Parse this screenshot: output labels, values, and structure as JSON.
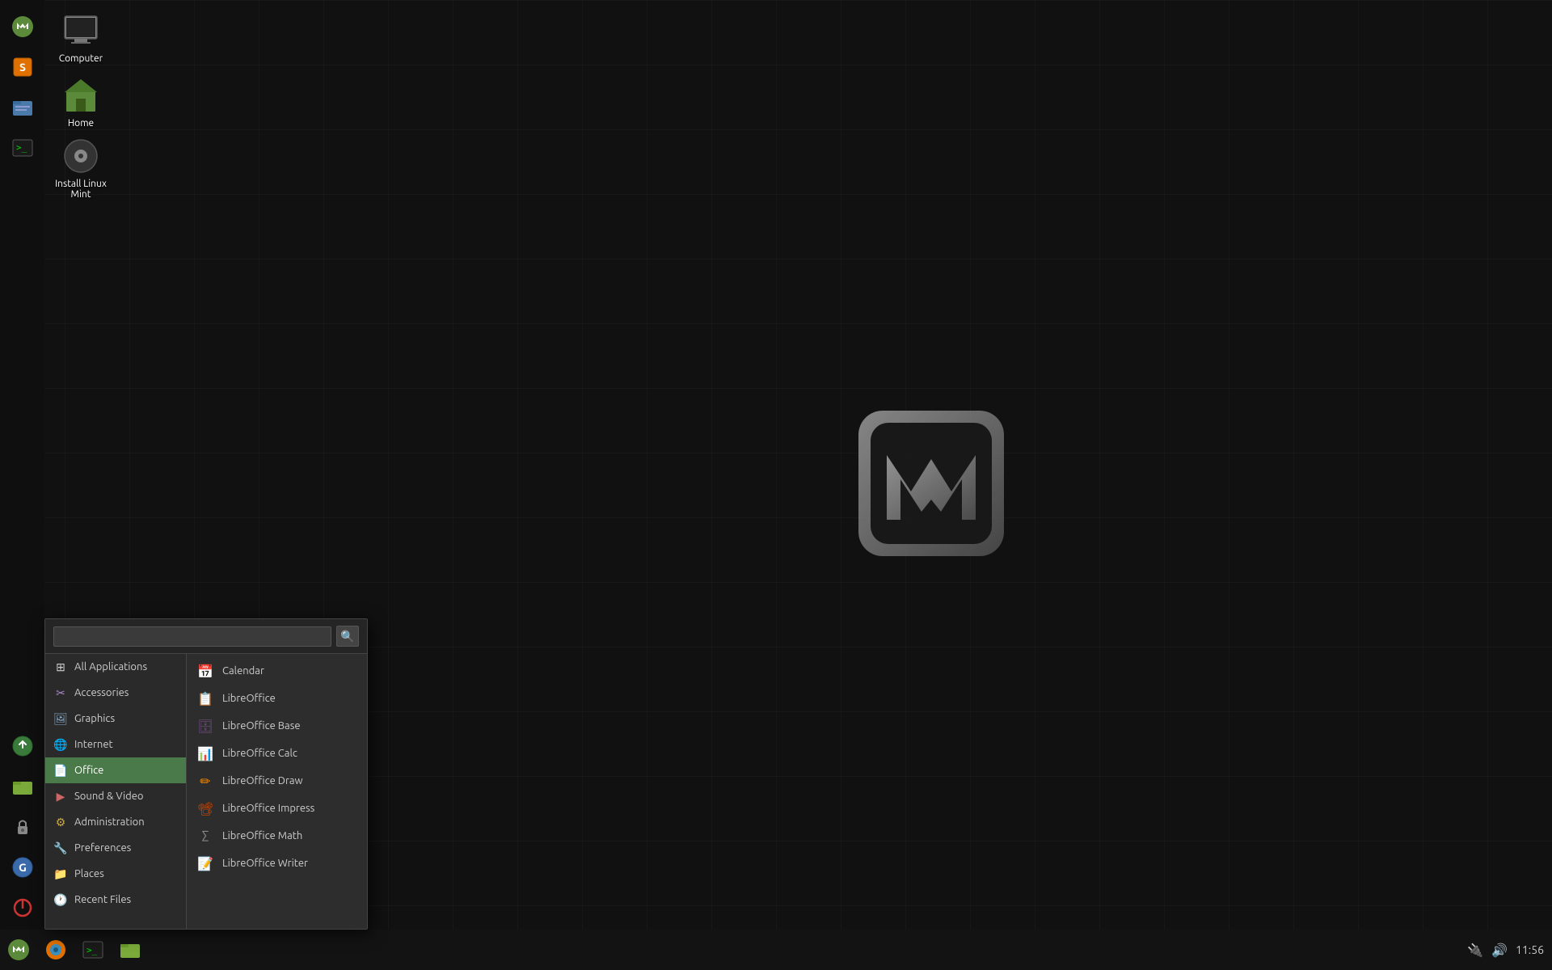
{
  "desktop": {
    "background_color": "#111111",
    "icons": [
      {
        "id": "computer",
        "label": "Computer",
        "icon": "computer"
      },
      {
        "id": "home",
        "label": "Home",
        "icon": "home"
      },
      {
        "id": "install",
        "label": "Install Linux Mint",
        "icon": "disk"
      }
    ]
  },
  "taskbar": {
    "time": "11:56",
    "icons": [
      {
        "id": "menu",
        "icon": "menu"
      },
      {
        "id": "firefox",
        "icon": "firefox"
      },
      {
        "id": "terminal",
        "icon": "terminal"
      },
      {
        "id": "files",
        "icon": "files"
      }
    ]
  },
  "left_panel": {
    "icons": [
      {
        "id": "mintmenu",
        "icon": "mint"
      },
      {
        "id": "software",
        "icon": "software"
      },
      {
        "id": "files2",
        "icon": "files2"
      },
      {
        "id": "terminal2",
        "icon": "terminal2"
      },
      {
        "id": "updates",
        "icon": "updates"
      },
      {
        "id": "folder",
        "icon": "folder"
      },
      {
        "id": "lock",
        "icon": "lock"
      },
      {
        "id": "feedback",
        "icon": "feedback"
      },
      {
        "id": "power",
        "icon": "power"
      }
    ]
  },
  "app_menu": {
    "search": {
      "placeholder": "",
      "value": ""
    },
    "categories": [
      {
        "id": "all",
        "label": "All Applications",
        "icon": "⊞",
        "active": false
      },
      {
        "id": "accessories",
        "label": "Accessories",
        "icon": "✂",
        "active": false
      },
      {
        "id": "graphics",
        "label": "Graphics",
        "icon": "🖼",
        "active": false
      },
      {
        "id": "internet",
        "label": "Internet",
        "icon": "🌐",
        "active": false
      },
      {
        "id": "office",
        "label": "Office",
        "icon": "📄",
        "active": true
      },
      {
        "id": "sound-video",
        "label": "Sound & Video",
        "icon": "▶",
        "active": false
      },
      {
        "id": "administration",
        "label": "Administration",
        "icon": "⚙",
        "active": false
      },
      {
        "id": "preferences",
        "label": "Preferences",
        "icon": "🔧",
        "active": false
      },
      {
        "id": "places",
        "label": "Places",
        "icon": "📁",
        "active": false
      },
      {
        "id": "recent",
        "label": "Recent Files",
        "icon": "🕐",
        "active": false
      }
    ],
    "apps": [
      {
        "id": "calendar",
        "label": "Calendar",
        "icon": "📅"
      },
      {
        "id": "libreoffice",
        "label": "LibreOffice",
        "icon": "📋"
      },
      {
        "id": "libreoffice-base",
        "label": "LibreOffice Base",
        "icon": "🗄"
      },
      {
        "id": "libreoffice-calc",
        "label": "LibreOffice Calc",
        "icon": "📊"
      },
      {
        "id": "libreoffice-draw",
        "label": "LibreOffice Draw",
        "icon": "✏"
      },
      {
        "id": "libreoffice-impress",
        "label": "LibreOffice Impress",
        "icon": "📽"
      },
      {
        "id": "libreoffice-math",
        "label": "LibreOffice Math",
        "icon": "∑"
      },
      {
        "id": "libreoffice-writer",
        "label": "LibreOffice Writer",
        "icon": "📝"
      }
    ]
  }
}
